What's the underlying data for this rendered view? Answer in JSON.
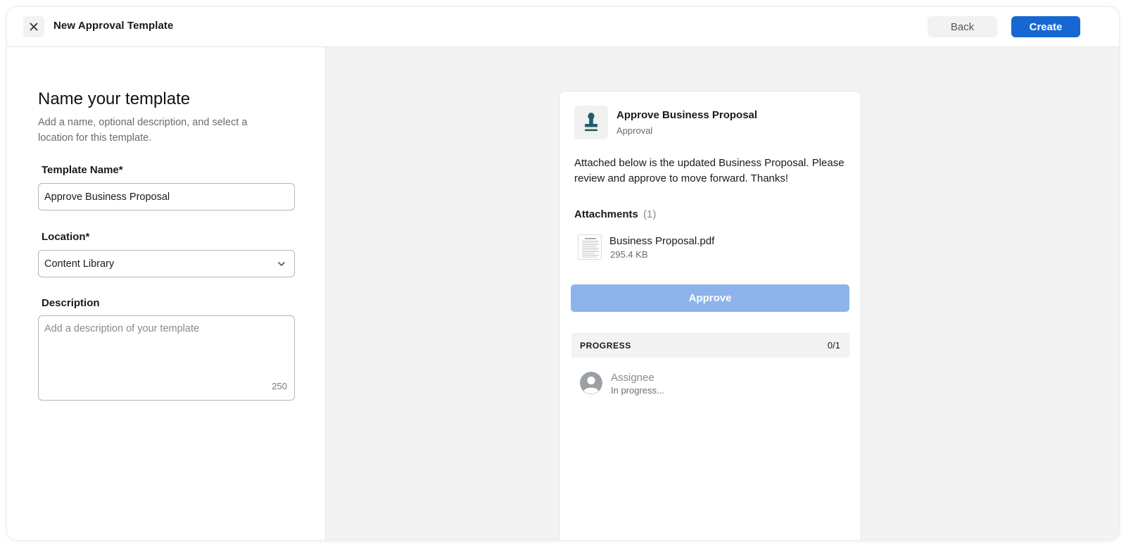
{
  "header": {
    "title": "New Approval Template",
    "back_label": "Back",
    "create_label": "Create"
  },
  "form": {
    "title": "Name your template",
    "subtitle": "Add a name, optional description, and select a location for this template.",
    "template_name": {
      "label": "Template Name*",
      "value": "Approve Business Proposal"
    },
    "location": {
      "label": "Location*",
      "value": "Content Library"
    },
    "description": {
      "label": "Description",
      "placeholder": "Add a description of your template",
      "char_count": "250"
    }
  },
  "preview": {
    "title": "Approve Business Proposal",
    "type": "Approval",
    "message": "Attached below is the updated Business Proposal. Please review and approve to move forward. Thanks!",
    "attachments": {
      "label": "Attachments",
      "count": "(1)",
      "files": [
        {
          "name": "Business Proposal.pdf",
          "size": "295.4 KB"
        }
      ]
    },
    "approve_label": "Approve",
    "progress": {
      "label": "PROGRESS",
      "count": "0/1"
    },
    "assignee": {
      "name": "Assignee",
      "status": "In progress..."
    }
  },
  "colors": {
    "primary": "#1767d3",
    "approve_disabled": "#8db3ea",
    "stamp_icon": "#1f5f6b"
  }
}
